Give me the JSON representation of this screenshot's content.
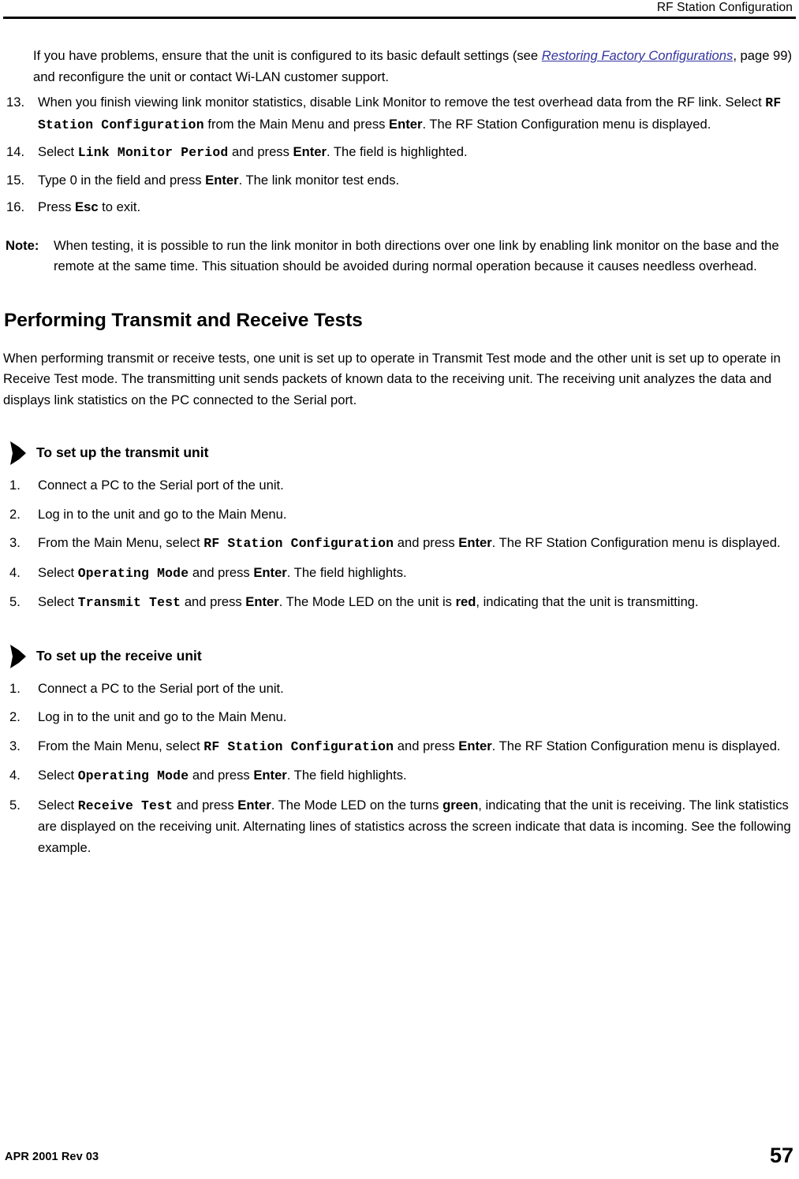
{
  "header": {
    "title": "RF Station Configuration"
  },
  "lead_paragraph": {
    "part1": "If you have problems, ensure that the unit is configured to its basic default settings (see ",
    "link": "Restoring Factory Configurations",
    "part2": ", page 99) and reconfigure the unit or contact Wi-LAN customer support."
  },
  "continued_steps": [
    {
      "num": "13.",
      "segments": [
        {
          "type": "text",
          "value": "When you finish viewing link monitor statistics, disable Link Monitor to remove the test overhead data from the RF link. Select "
        },
        {
          "type": "mono",
          "value": "RF Station Configuration"
        },
        {
          "type": "text",
          "value": " from the Main Menu and press "
        },
        {
          "type": "bold",
          "value": "Enter"
        },
        {
          "type": "text",
          "value": ". The RF Station Configuration menu is displayed."
        }
      ]
    },
    {
      "num": "14.",
      "segments": [
        {
          "type": "text",
          "value": "Select "
        },
        {
          "type": "mono",
          "value": "Link Monitor Period"
        },
        {
          "type": "text",
          "value": " and press "
        },
        {
          "type": "bold",
          "value": "Enter"
        },
        {
          "type": "text",
          "value": ". The field is highlighted."
        }
      ]
    },
    {
      "num": "15.",
      "segments": [
        {
          "type": "text",
          "value": "Type 0 in the field and press "
        },
        {
          "type": "bold",
          "value": "Enter"
        },
        {
          "type": "text",
          "value": ". The link monitor test ends."
        }
      ]
    },
    {
      "num": "16.",
      "segments": [
        {
          "type": "text",
          "value": "Press "
        },
        {
          "type": "bold",
          "value": "Esc"
        },
        {
          "type": "text",
          "value": " to exit."
        }
      ]
    }
  ],
  "note": {
    "label": "Note:",
    "text": "When testing, it is possible to run the link monitor in both directions over one link by enabling link monitor on the base and the remote at the same time. This situation should be avoided during normal operation because it causes needless overhead."
  },
  "section": {
    "heading": "Performing Transmit and Receive Tests",
    "intro": "When performing transmit or receive tests, one unit is set up to operate in Transmit Test mode and the other unit is set up to operate in Receive Test mode. The transmitting unit sends packets of known data to the receiving unit. The receiving unit analyzes the data and displays link statistics on the PC connected to the Serial port."
  },
  "procedures": [
    {
      "arrow_icon": "right-arrow-icon",
      "title": "To set up the transmit unit",
      "steps": [
        {
          "num": "1.",
          "segments": [
            {
              "type": "text",
              "value": "Connect a PC to the Serial port of the unit."
            }
          ]
        },
        {
          "num": "2.",
          "segments": [
            {
              "type": "text",
              "value": "Log in to the unit and go to the Main Menu."
            }
          ]
        },
        {
          "num": "3.",
          "segments": [
            {
              "type": "text",
              "value": "From the Main Menu, select "
            },
            {
              "type": "mono",
              "value": "RF Station Configuration"
            },
            {
              "type": "text",
              "value": " and press "
            },
            {
              "type": "bold",
              "value": "Enter"
            },
            {
              "type": "text",
              "value": ". The RF Station Configuration menu is displayed."
            }
          ]
        },
        {
          "num": "4.",
          "segments": [
            {
              "type": "text",
              "value": "Select "
            },
            {
              "type": "mono",
              "value": "Operating Mode"
            },
            {
              "type": "text",
              "value": " and press "
            },
            {
              "type": "bold",
              "value": "Enter"
            },
            {
              "type": "text",
              "value": ". The field highlights."
            }
          ]
        },
        {
          "num": "5.",
          "segments": [
            {
              "type": "text",
              "value": "Select "
            },
            {
              "type": "mono",
              "value": "Transmit Test"
            },
            {
              "type": "text",
              "value": " and press "
            },
            {
              "type": "bold",
              "value": "Enter"
            },
            {
              "type": "text",
              "value": ". The Mode LED on the unit is "
            },
            {
              "type": "bold",
              "value": "red"
            },
            {
              "type": "text",
              "value": ", indicating that the unit is transmitting."
            }
          ]
        }
      ]
    },
    {
      "arrow_icon": "right-arrow-icon",
      "title": "To set up the receive unit",
      "steps": [
        {
          "num": "1.",
          "segments": [
            {
              "type": "text",
              "value": "Connect a PC to the Serial port of the unit."
            }
          ]
        },
        {
          "num": "2.",
          "segments": [
            {
              "type": "text",
              "value": "Log in to the unit and go to the Main Menu."
            }
          ]
        },
        {
          "num": "3.",
          "segments": [
            {
              "type": "text",
              "value": "From the Main Menu, select "
            },
            {
              "type": "mono",
              "value": "RF Station Configuration"
            },
            {
              "type": "text",
              "value": " and press "
            },
            {
              "type": "bold",
              "value": "Enter"
            },
            {
              "type": "text",
              "value": ". The RF Station Configuration menu is displayed."
            }
          ]
        },
        {
          "num": "4.",
          "segments": [
            {
              "type": "text",
              "value": "Select "
            },
            {
              "type": "mono",
              "value": "Operating Mode"
            },
            {
              "type": "text",
              "value": " and press "
            },
            {
              "type": "bold",
              "value": "Enter"
            },
            {
              "type": "text",
              "value": ". The field highlights."
            }
          ]
        },
        {
          "num": "5.",
          "segments": [
            {
              "type": "text",
              "value": "Select "
            },
            {
              "type": "mono",
              "value": "Receive Test"
            },
            {
              "type": "text",
              "value": " and press "
            },
            {
              "type": "bold",
              "value": "Enter"
            },
            {
              "type": "text",
              "value": ". The Mode LED on the turns "
            },
            {
              "type": "bold",
              "value": "green"
            },
            {
              "type": "text",
              "value": ", indicating that the unit is receiving. The link statistics are displayed on the receiving unit. Alternating lines of statistics across the screen indicate that data is incoming. See the following example."
            }
          ]
        }
      ]
    }
  ],
  "footer": {
    "left": "APR 2001 Rev 03",
    "page_number": "57"
  },
  "colors": {
    "link": "#3333a0",
    "text": "#000000",
    "background": "#ffffff"
  }
}
